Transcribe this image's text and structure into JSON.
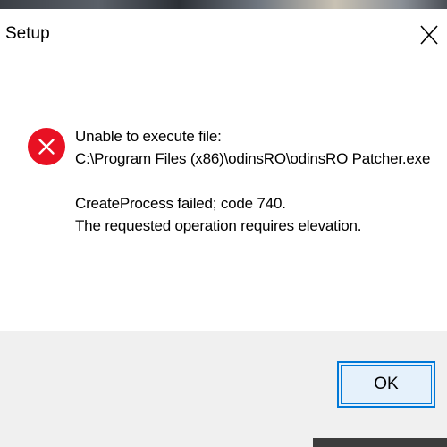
{
  "window": {
    "title": "Setup",
    "close_icon": "close-icon"
  },
  "message": {
    "icon": "error-icon",
    "icon_color": "#e81123",
    "line1": "Unable to execute file:",
    "line2": "C:\\Program Files (x86)\\odinsRO\\odinsRO Patcher.exe",
    "line3": "CreateProcess failed; code 740.",
    "line4": "The requested operation requires elevation."
  },
  "buttons": {
    "ok_label": "OK"
  },
  "colors": {
    "accent": "#0078d7",
    "footer_bg": "#f0f0f0"
  }
}
